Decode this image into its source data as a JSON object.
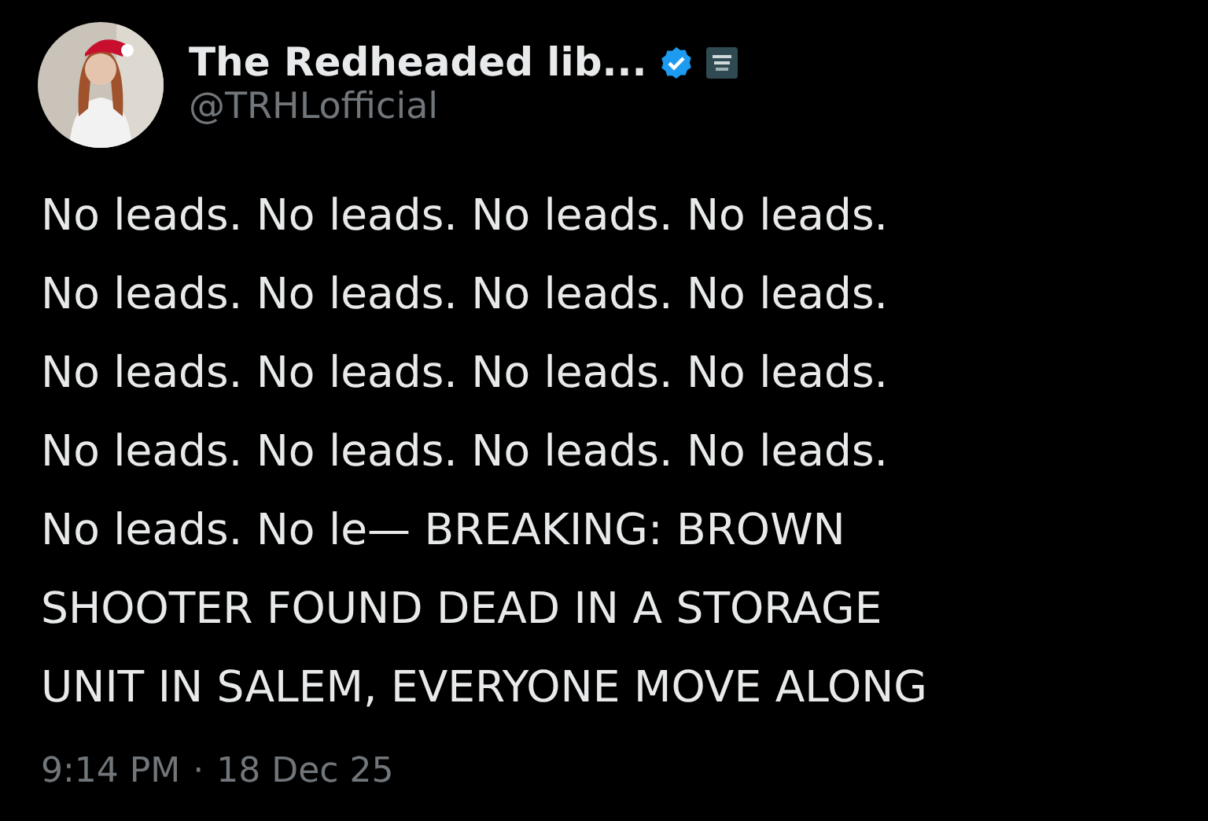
{
  "author": {
    "name": "The Redheaded lib...",
    "handle": "@TRHLofficial",
    "verified": true
  },
  "text_lines": [
    "No leads. No leads. No leads. No leads.",
    "No leads. No leads. No leads. No leads.",
    "No leads. No leads. No leads. No leads.",
    "No leads. No leads. No leads. No leads.",
    "No leads. No le— BREAKING: BROWN",
    "SHOOTER FOUND DEAD IN A STORAGE",
    "UNIT IN SALEM, EVERYONE MOVE ALONG"
  ],
  "timestamp": {
    "time": "9:14 PM",
    "separator": "·",
    "date": "18 Dec 25"
  }
}
